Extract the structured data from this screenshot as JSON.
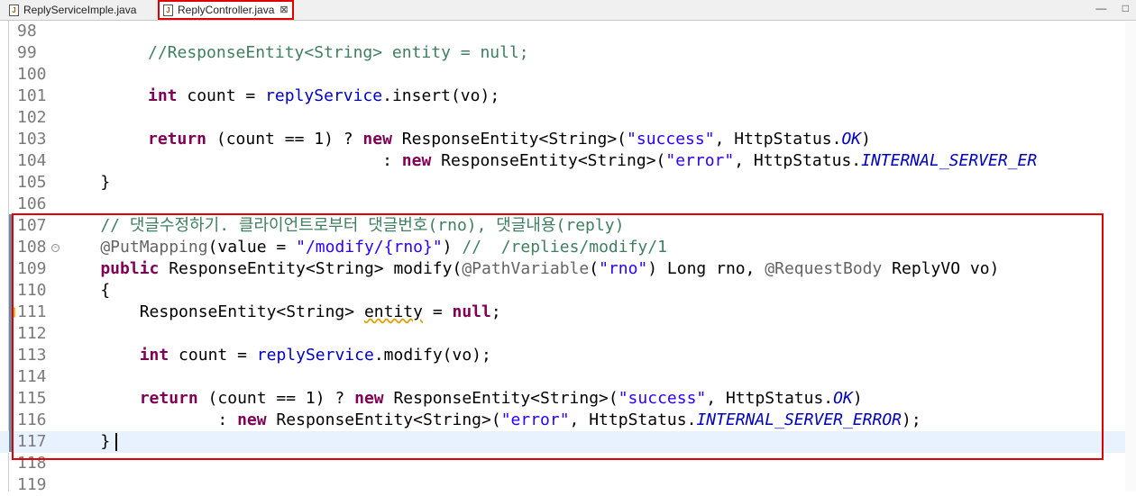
{
  "tabs": [
    {
      "label": "ReplyServiceImple.java",
      "active": false
    },
    {
      "label": "ReplyController.java",
      "active": true
    }
  ],
  "tab_close_glyph": "⊠",
  "window_buttons": {
    "minimize": "—",
    "maximize": "□"
  },
  "lines": [
    {
      "n": "98"
    },
    {
      "n": "99"
    },
    {
      "n": "100"
    },
    {
      "n": "101"
    },
    {
      "n": "102"
    },
    {
      "n": "103"
    },
    {
      "n": "104"
    },
    {
      "n": "105"
    },
    {
      "n": "106"
    },
    {
      "n": "107"
    },
    {
      "n": "108"
    },
    {
      "n": "109"
    },
    {
      "n": "110"
    },
    {
      "n": "111"
    },
    {
      "n": "112"
    },
    {
      "n": "113"
    },
    {
      "n": "114"
    },
    {
      "n": "115"
    },
    {
      "n": "116"
    },
    {
      "n": "117"
    },
    {
      "n": "118"
    },
    {
      "n": "119"
    }
  ],
  "code": {
    "l99_comment": "//ResponseEntity<String> entity = null;",
    "l101_type": "int",
    "l101_var": " count = ",
    "l101_field": "replyService",
    "l101_rest": ".insert(vo);",
    "l103_ret": "return",
    "l103_a": " (count == 1) ? ",
    "l103_new": "new",
    "l103_b": " ResponseEntity<String>(",
    "l103_str": "\"success\"",
    "l103_c": ", HttpStatus.",
    "l103_const": "OK",
    "l103_d": ")",
    "l104_a": "                        : ",
    "l104_new": "new",
    "l104_b": " ResponseEntity<String>(",
    "l104_str": "\"error\"",
    "l104_c": ", HttpStatus.",
    "l104_const": "INTERNAL_SERVER_ER",
    "l105": "    }",
    "l107_comment": "    // 댓글수정하기. 클라이언트로부터 댓글번호(rno), 댓글내용(reply)",
    "l108_ann": "    @PutMapping",
    "l108_a": "(value = ",
    "l108_str": "\"/modify/{rno}\"",
    "l108_b": ") ",
    "l108_comment": "//  /replies/modify/1",
    "l109_kw": "    public",
    "l109_a": " ResponseEntity<String> modify(",
    "l109_ann1": "@PathVariable",
    "l109_b": "(",
    "l109_str": "\"rno\"",
    "l109_c": ") Long rno, ",
    "l109_ann2": "@RequestBody",
    "l109_d": " ReplyVO vo)",
    "l110": "    {",
    "l111_a": "        ResponseEntity<String> ",
    "l111_var": "entity",
    "l111_b": " = ",
    "l111_null": "null",
    "l111_c": ";",
    "l113_type": "        int",
    "l113_var": " count = ",
    "l113_field": "replyService",
    "l113_rest": ".modify(vo);",
    "l115_ret": "        return",
    "l115_a": " (count == 1) ? ",
    "l115_new": "new",
    "l115_b": " ResponseEntity<String>(",
    "l115_str": "\"success\"",
    "l115_c": ", HttpStatus.",
    "l115_const": "OK",
    "l115_d": ")",
    "l116_a": "                : ",
    "l116_new": "new",
    "l116_b": " ResponseEntity<String>(",
    "l116_str": "\"error\"",
    "l116_c": ", HttpStatus.",
    "l116_const": "INTERNAL_SERVER_ERROR",
    "l116_d": ");",
    "l117": "    }"
  },
  "colors": {
    "keyword": "#7f0055",
    "comment": "#3f7f5f",
    "string": "#2a00ff",
    "field": "#0000c0",
    "annotation": "#646464",
    "highlight_box": "#e00000",
    "current_line": "#e8f2fe"
  }
}
